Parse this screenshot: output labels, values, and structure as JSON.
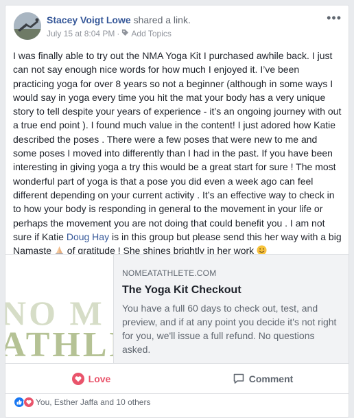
{
  "post": {
    "author": "Stacey Voigt Lowe",
    "action": "shared a link.",
    "date": "July 15 at 8:04 PM",
    "separator": "·",
    "add_topics": "Add Topics",
    "more_label": "•••",
    "text_part1": "I was finally able to try out the NMA Yoga Kit I purchased awhile back. I just can not say enough nice words for how much I enjoyed it. I’ve been practicing yoga for over 8 years so not a beginner (although in some ways I would say in yoga every time you hit the mat your body has a very unique story to tell despite your years of experience - it’s an ongoing journey with out a true end point ). I found much value in the content! I just adored how Katie described the poses . There were a few poses that were new to me and some poses I moved into differently than I had in the past. If you have been interesting in giving yoga a try this would be a great start for sure ! The most wonderful part of yoga is that a pose you did even a week ago can feel different depending on your current activity . It’s an effective way to check in to how your body is responding in general to the movement in your life or perhaps the movement you are not doing that could benefit you . I am not sure if Katie ",
    "tagged_name": "Doug Hay",
    "text_part2": " is in this group but please send this her way with a big Namaste ",
    "text_part3": " of gratitude ! She shines brightly in her work "
  },
  "link": {
    "thumb_line1": "NO M",
    "thumb_line2": "ATHLE",
    "domain": "NOMEATATHLETE.COM",
    "title": "The Yoga Kit Checkout",
    "description": "You have a full 60 days to check out, test, and preview, and if at any point you decide it's not right for you, we'll issue a full refund. No questions asked."
  },
  "actions": {
    "love_label": "Love",
    "comment_label": "Comment"
  },
  "reactions": {
    "summary": "You, Esther Jaffa and 10 others"
  },
  "colors": {
    "link_blue": "#365899",
    "love_red": "#e9546b",
    "like_blue": "#1877f2"
  },
  "icons": [
    "globe-icon",
    "tag-icon",
    "heart-icon",
    "comment-icon",
    "like-reaction-icon",
    "love-reaction-icon",
    "pray-emoji",
    "smile-emoji"
  ]
}
